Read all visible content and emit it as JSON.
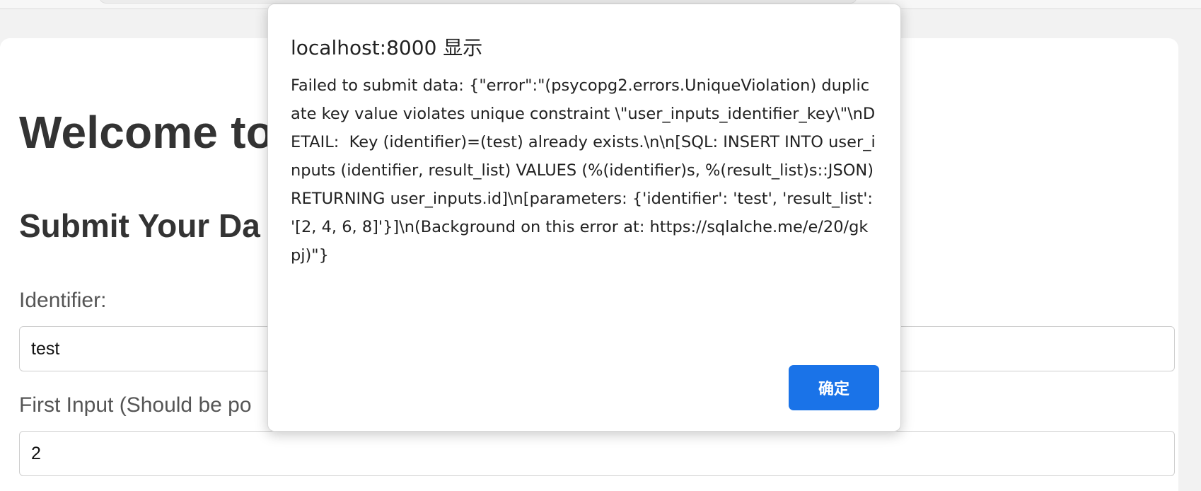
{
  "page": {
    "title": "Welcome to",
    "section_title": "Submit Your Da",
    "identifier_label": "Identifier:",
    "identifier_value": "test",
    "first_input_label": "First Input (Should be po",
    "first_input_value": "2"
  },
  "dialog": {
    "title": "localhost:8000 显示",
    "message": "Failed to submit data: {\"error\":\"(psycopg2.errors.UniqueViolation) duplicate key value violates unique constraint \\\"user_inputs_identifier_key\\\"\\nDETAIL:  Key (identifier)=(test) already exists.\\n\\n[SQL: INSERT INTO user_inputs (identifier, result_list) VALUES (%(identifier)s, %(result_list)s::JSON) RETURNING user_inputs.id]\\n[parameters: {'identifier': 'test', 'result_list': '[2, 4, 6, 8]'}]\\n(Background on this error at: https://sqlalche.me/e/20/gkpj)\"}",
    "ok_label": "确定"
  },
  "colors": {
    "accent": "#1a73e8",
    "page_background": "#f2f2f2",
    "card_background": "#ffffff",
    "heading_text": "#333333"
  }
}
